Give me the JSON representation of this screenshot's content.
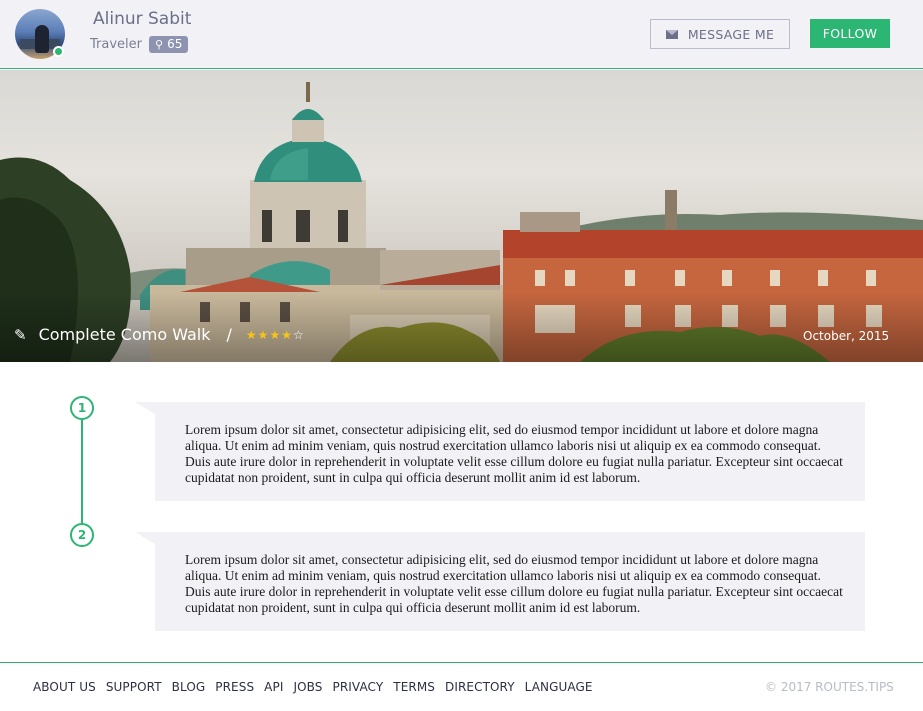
{
  "profile": {
    "name": "Alinur Sabit",
    "role": "Traveler",
    "badge_count": "65",
    "badge_icon": "map-marker-icon",
    "online": true
  },
  "actions": {
    "message_label": "MESSAGE ME",
    "message_icon": "envelope-icon",
    "follow_label": "FOLLOW"
  },
  "hero": {
    "title": "Complete Como Walk",
    "separator": "/",
    "rating": 4,
    "rating_max": 5,
    "date": "October, 2015"
  },
  "timeline": [
    {
      "number": "1",
      "text": "Lorem ipsum dolor sit amet, consectetur adipisicing elit, sed do eiusmod tempor incididunt ut labore et dolore magna aliqua. Ut enim ad minim veniam, quis nostrud exercitation ullamco laboris nisi ut aliquip ex ea commodo consequat. Duis aute irure dolor in reprehenderit in voluptate velit esse cillum dolore eu fugiat nulla pariatur. Excepteur sint occaecat cupidatat non proident, sunt in culpa qui officia deserunt mollit anim id est laborum."
    },
    {
      "number": "2",
      "text": "Lorem ipsum dolor sit amet, consectetur adipisicing elit, sed do eiusmod tempor incididunt ut labore et dolore magna aliqua. Ut enim ad minim veniam, quis nostrud exercitation ullamco laboris nisi ut aliquip ex ea commodo consequat. Duis aute irure dolor in reprehenderit in voluptate velit esse cillum dolore eu fugiat nulla pariatur. Excepteur sint occaecat cupidatat non proident, sunt in culpa qui officia deserunt mollit anim id est laborum."
    }
  ],
  "footer": {
    "links": [
      "ABOUT US",
      "SUPPORT",
      "BLOG",
      "PRESS",
      "API",
      "JOBS",
      "PRIVACY",
      "TERMS",
      "DIRECTORY",
      "LANGUAGE"
    ],
    "copyright": "© 2017 ROUTES.TIPS"
  },
  "colors": {
    "accent": "#2bb673",
    "header_bg": "#f2f2f6",
    "card_bg": "#f2f2f6",
    "star": "#f5c518"
  }
}
